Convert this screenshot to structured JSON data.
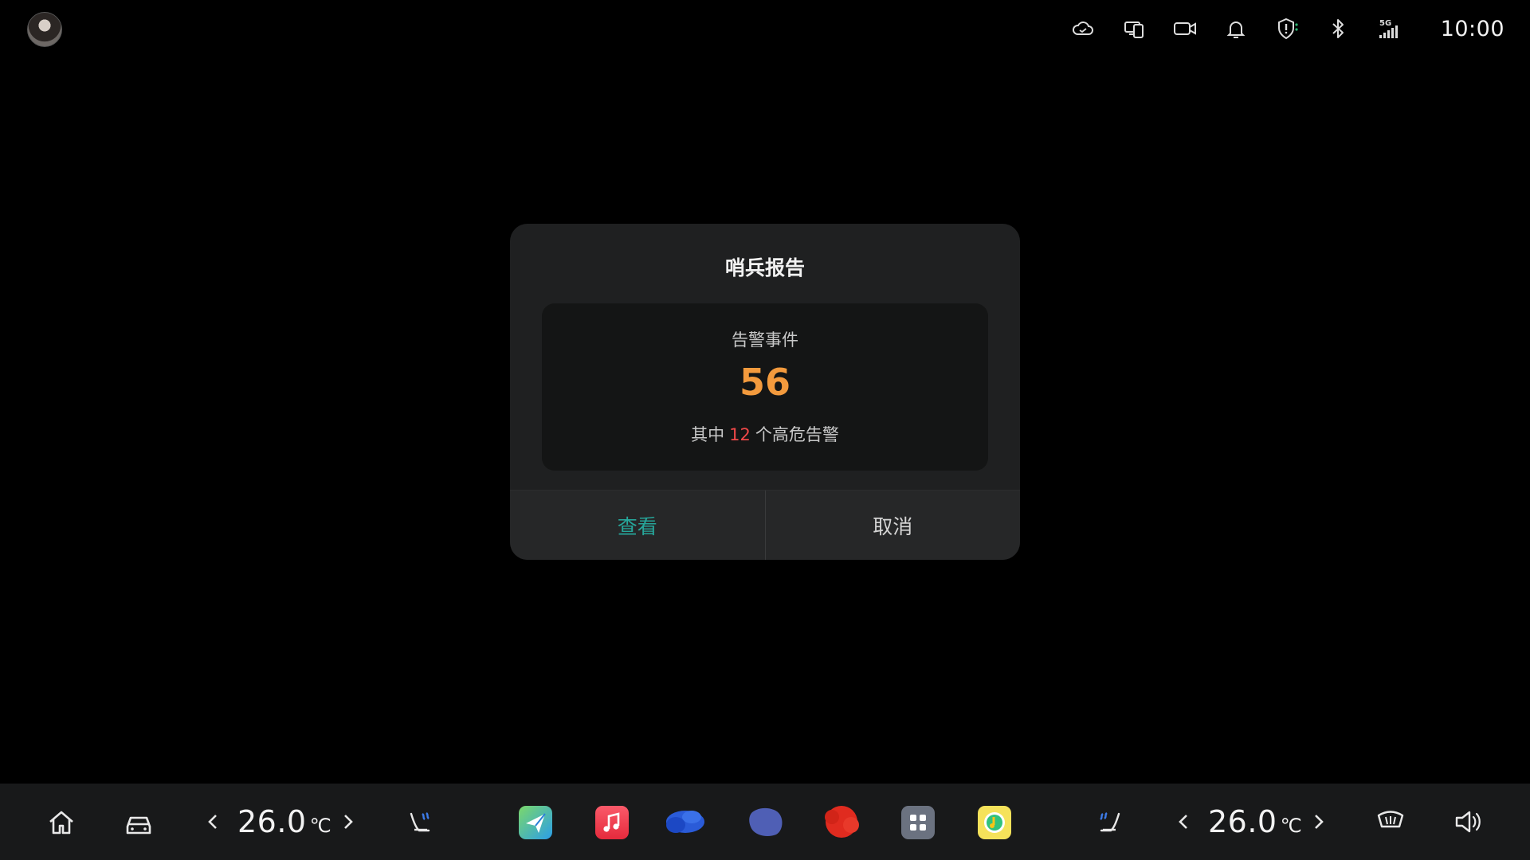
{
  "status_bar": {
    "time": "10:00",
    "icons": [
      "avatar",
      "cloud-icon",
      "multi-screen-icon",
      "camera-icon",
      "bell-icon",
      "shield-icon",
      "bluetooth-icon",
      "5g-signal-icon"
    ],
    "signal_label": "5G"
  },
  "dialog": {
    "title": "哨兵报告",
    "card": {
      "label": "告警事件",
      "count": "56",
      "sub_prefix": "其中",
      "high_count": "12",
      "sub_suffix": "个高危告警"
    },
    "buttons": {
      "view": "查看",
      "cancel": "取消"
    }
  },
  "dock": {
    "left_temp": "26.0",
    "right_temp": "26.0",
    "temp_unit": "℃",
    "apps": [
      "navigation-app",
      "music-app",
      "blurred-app-1",
      "blurred-app-2",
      "blurred-app-3",
      "all-apps",
      "qq-music-app"
    ]
  },
  "colors": {
    "accent_green": "#26a69a",
    "count_orange": "#f39a3d",
    "high_risk_red": "#f04848"
  }
}
